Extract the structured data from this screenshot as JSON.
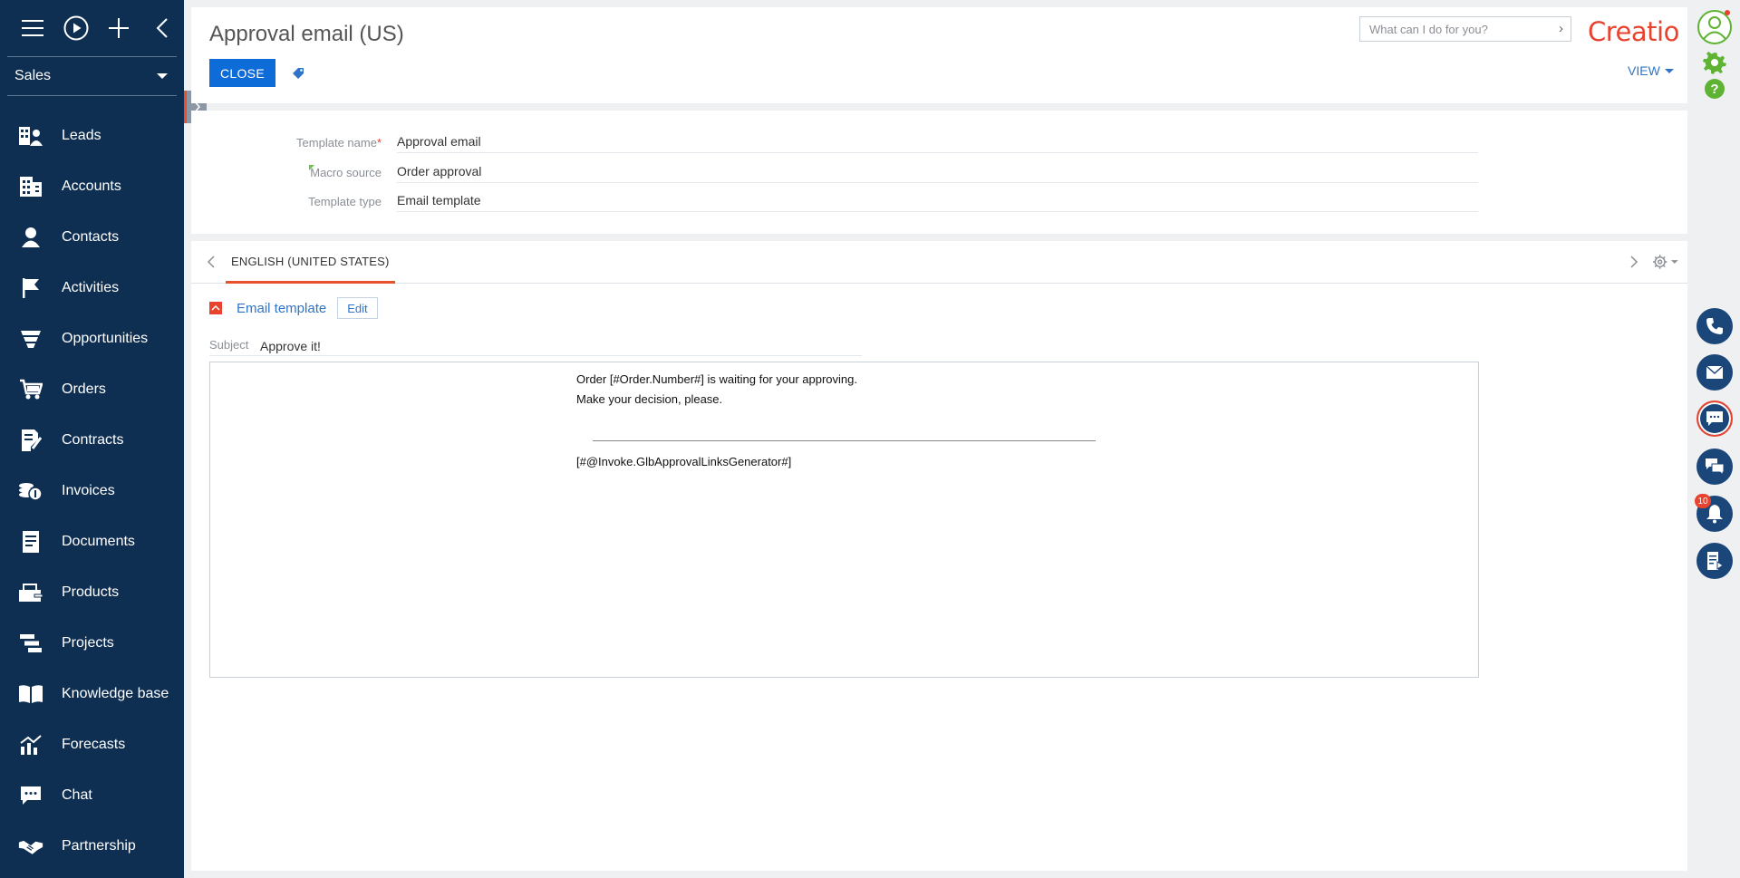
{
  "sidebar": {
    "workspace": "Sales",
    "items": [
      {
        "label": "Leads",
        "icon": "leads-icon"
      },
      {
        "label": "Accounts",
        "icon": "accounts-icon"
      },
      {
        "label": "Contacts",
        "icon": "contacts-icon"
      },
      {
        "label": "Activities",
        "icon": "activities-icon"
      },
      {
        "label": "Opportunities",
        "icon": "opportunities-icon"
      },
      {
        "label": "Orders",
        "icon": "orders-icon"
      },
      {
        "label": "Contracts",
        "icon": "contracts-icon"
      },
      {
        "label": "Invoices",
        "icon": "invoices-icon"
      },
      {
        "label": "Documents",
        "icon": "documents-icon"
      },
      {
        "label": "Products",
        "icon": "products-icon"
      },
      {
        "label": "Projects",
        "icon": "projects-icon"
      },
      {
        "label": "Knowledge base",
        "icon": "knowledge-base-icon"
      },
      {
        "label": "Forecasts",
        "icon": "forecasts-icon"
      },
      {
        "label": "Chat",
        "icon": "chat-icon"
      },
      {
        "label": "Partnership",
        "icon": "partnership-icon"
      }
    ]
  },
  "header": {
    "title": "Approval email (US)",
    "close_label": "CLOSE",
    "search_placeholder": "What can I do for you?",
    "logo": "Creatio",
    "view_label": "VIEW"
  },
  "fields": {
    "template_name": {
      "label": "Template name",
      "required_mark": "*",
      "value": "Approval email"
    },
    "macro_source": {
      "label": "Macro source",
      "value": "Order approval"
    },
    "template_type": {
      "label": "Template type",
      "value": "Email template"
    }
  },
  "content": {
    "tab_label": "ENGLISH (UNITED STATES)",
    "section_title": "Email template",
    "edit_label": "Edit",
    "subject_label": "Subject",
    "subject_value": "Approve it!",
    "body": {
      "line1": "Order [#Order.Number#] is waiting for your approving.",
      "line2": "Make your decision, please.",
      "line3": "[#@Invoke.GlbApprovalLinksGenerator#]"
    }
  },
  "rail": {
    "notification_count": "10"
  },
  "colors": {
    "sidebar_bg": "#0f2f52",
    "accent_orange": "#e8512c",
    "primary_blue": "#0e6cd8",
    "link_blue": "#2f74c9",
    "rail_blue": "#1a467a",
    "gear_green": "#5fb333"
  }
}
